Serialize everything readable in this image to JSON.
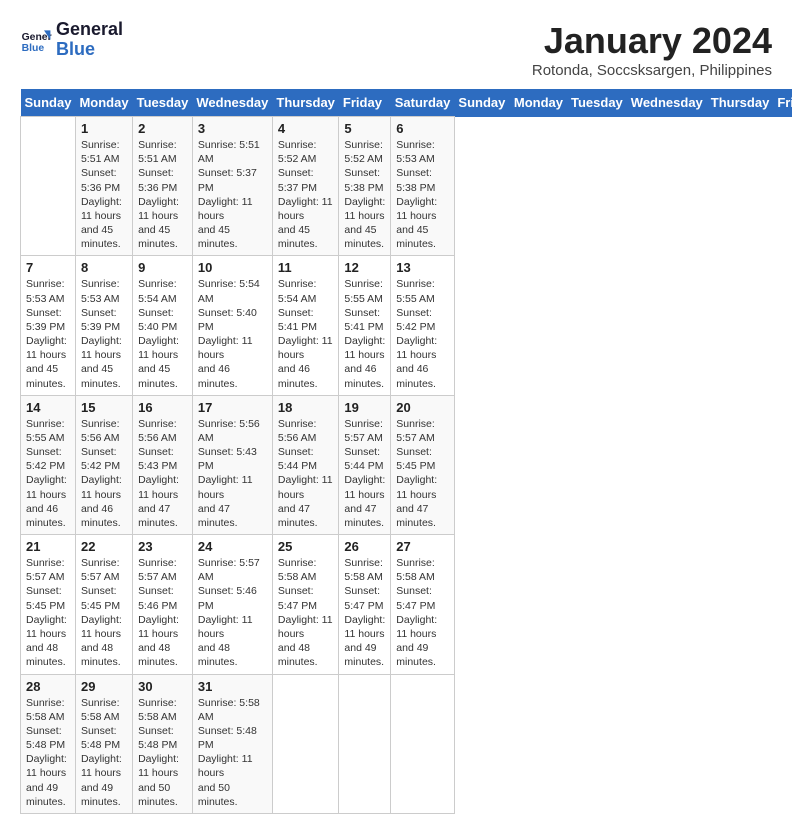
{
  "logo": {
    "line1": "General",
    "line2": "Blue"
  },
  "title": "January 2024",
  "location": "Rotonda, Soccsksargen, Philippines",
  "days_of_week": [
    "Sunday",
    "Monday",
    "Tuesday",
    "Wednesday",
    "Thursday",
    "Friday",
    "Saturday"
  ],
  "weeks": [
    [
      {
        "day": "",
        "info": ""
      },
      {
        "day": "1",
        "info": "Sunrise: 5:51 AM\nSunset: 5:36 PM\nDaylight: 11 hours\nand 45 minutes."
      },
      {
        "day": "2",
        "info": "Sunrise: 5:51 AM\nSunset: 5:36 PM\nDaylight: 11 hours\nand 45 minutes."
      },
      {
        "day": "3",
        "info": "Sunrise: 5:51 AM\nSunset: 5:37 PM\nDaylight: 11 hours\nand 45 minutes."
      },
      {
        "day": "4",
        "info": "Sunrise: 5:52 AM\nSunset: 5:37 PM\nDaylight: 11 hours\nand 45 minutes."
      },
      {
        "day": "5",
        "info": "Sunrise: 5:52 AM\nSunset: 5:38 PM\nDaylight: 11 hours\nand 45 minutes."
      },
      {
        "day": "6",
        "info": "Sunrise: 5:53 AM\nSunset: 5:38 PM\nDaylight: 11 hours\nand 45 minutes."
      }
    ],
    [
      {
        "day": "7",
        "info": "Sunrise: 5:53 AM\nSunset: 5:39 PM\nDaylight: 11 hours\nand 45 minutes."
      },
      {
        "day": "8",
        "info": "Sunrise: 5:53 AM\nSunset: 5:39 PM\nDaylight: 11 hours\nand 45 minutes."
      },
      {
        "day": "9",
        "info": "Sunrise: 5:54 AM\nSunset: 5:40 PM\nDaylight: 11 hours\nand 45 minutes."
      },
      {
        "day": "10",
        "info": "Sunrise: 5:54 AM\nSunset: 5:40 PM\nDaylight: 11 hours\nand 46 minutes."
      },
      {
        "day": "11",
        "info": "Sunrise: 5:54 AM\nSunset: 5:41 PM\nDaylight: 11 hours\nand 46 minutes."
      },
      {
        "day": "12",
        "info": "Sunrise: 5:55 AM\nSunset: 5:41 PM\nDaylight: 11 hours\nand 46 minutes."
      },
      {
        "day": "13",
        "info": "Sunrise: 5:55 AM\nSunset: 5:42 PM\nDaylight: 11 hours\nand 46 minutes."
      }
    ],
    [
      {
        "day": "14",
        "info": "Sunrise: 5:55 AM\nSunset: 5:42 PM\nDaylight: 11 hours\nand 46 minutes."
      },
      {
        "day": "15",
        "info": "Sunrise: 5:56 AM\nSunset: 5:42 PM\nDaylight: 11 hours\nand 46 minutes."
      },
      {
        "day": "16",
        "info": "Sunrise: 5:56 AM\nSunset: 5:43 PM\nDaylight: 11 hours\nand 47 minutes."
      },
      {
        "day": "17",
        "info": "Sunrise: 5:56 AM\nSunset: 5:43 PM\nDaylight: 11 hours\nand 47 minutes."
      },
      {
        "day": "18",
        "info": "Sunrise: 5:56 AM\nSunset: 5:44 PM\nDaylight: 11 hours\nand 47 minutes."
      },
      {
        "day": "19",
        "info": "Sunrise: 5:57 AM\nSunset: 5:44 PM\nDaylight: 11 hours\nand 47 minutes."
      },
      {
        "day": "20",
        "info": "Sunrise: 5:57 AM\nSunset: 5:45 PM\nDaylight: 11 hours\nand 47 minutes."
      }
    ],
    [
      {
        "day": "21",
        "info": "Sunrise: 5:57 AM\nSunset: 5:45 PM\nDaylight: 11 hours\nand 48 minutes."
      },
      {
        "day": "22",
        "info": "Sunrise: 5:57 AM\nSunset: 5:45 PM\nDaylight: 11 hours\nand 48 minutes."
      },
      {
        "day": "23",
        "info": "Sunrise: 5:57 AM\nSunset: 5:46 PM\nDaylight: 11 hours\nand 48 minutes."
      },
      {
        "day": "24",
        "info": "Sunrise: 5:57 AM\nSunset: 5:46 PM\nDaylight: 11 hours\nand 48 minutes."
      },
      {
        "day": "25",
        "info": "Sunrise: 5:58 AM\nSunset: 5:47 PM\nDaylight: 11 hours\nand 48 minutes."
      },
      {
        "day": "26",
        "info": "Sunrise: 5:58 AM\nSunset: 5:47 PM\nDaylight: 11 hours\nand 49 minutes."
      },
      {
        "day": "27",
        "info": "Sunrise: 5:58 AM\nSunset: 5:47 PM\nDaylight: 11 hours\nand 49 minutes."
      }
    ],
    [
      {
        "day": "28",
        "info": "Sunrise: 5:58 AM\nSunset: 5:48 PM\nDaylight: 11 hours\nand 49 minutes."
      },
      {
        "day": "29",
        "info": "Sunrise: 5:58 AM\nSunset: 5:48 PM\nDaylight: 11 hours\nand 49 minutes."
      },
      {
        "day": "30",
        "info": "Sunrise: 5:58 AM\nSunset: 5:48 PM\nDaylight: 11 hours\nand 50 minutes."
      },
      {
        "day": "31",
        "info": "Sunrise: 5:58 AM\nSunset: 5:48 PM\nDaylight: 11 hours\nand 50 minutes."
      },
      {
        "day": "",
        "info": ""
      },
      {
        "day": "",
        "info": ""
      },
      {
        "day": "",
        "info": ""
      }
    ]
  ]
}
